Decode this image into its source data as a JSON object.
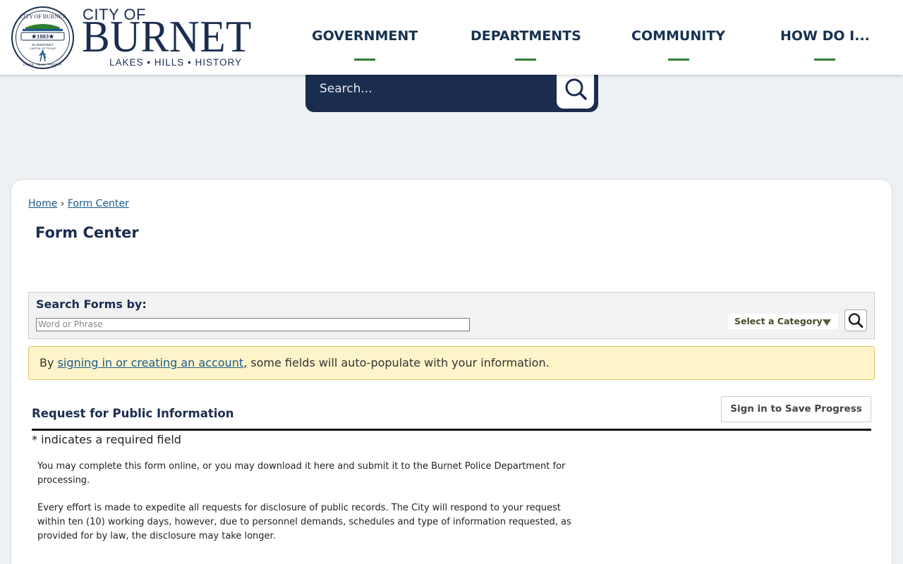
{
  "header": {
    "brand_top": "CITY OF",
    "brand_main": "BURNET",
    "brand_sub": "LAKES • HILLS • HISTORY",
    "seal": {
      "ring_text": "CITY OF BURNET",
      "year": "★1883★",
      "ribbon_text": "BLUEBONNET",
      "subtitle": "CAPITAL OF TEXAS",
      "bottom_text": "LAKES · HILLS · HISTORY"
    },
    "nav": [
      "GOVERNMENT",
      "DEPARTMENTS",
      "COMMUNITY",
      "HOW DO I..."
    ]
  },
  "site_search": {
    "placeholder": "Search..."
  },
  "breadcrumb": {
    "home": "Home",
    "separator": "›",
    "current": "Form Center"
  },
  "page_title": "Form Center",
  "search_forms": {
    "label": "Search Forms by:",
    "placeholder": "Word or Phrase",
    "category": "Select a Category"
  },
  "notice": {
    "prefix": "By ",
    "link": "signing in or creating an account",
    "suffix": ", some fields will auto-populate with your information."
  },
  "form": {
    "title": "Request for Public Information",
    "sign_in_button": "Sign in to Save Progress",
    "required_note": "* indicates a required field",
    "paragraph_1": "You may complete this form online, or you may download it here and submit it to the Burnet Police Department for processing.",
    "paragraph_2": "Every effort is made to expedite all requests for disclosure of public records. The City will respond to your request within ten (10) working days, however, due to personnel demands, schedules and type of information requested, as provided for by law, the disclosure may take longer."
  },
  "colors": {
    "navy": "#1b2d4f",
    "accent_green": "#2e7d32",
    "link": "#1b5a8c",
    "notice_bg": "#fdf4c9"
  }
}
